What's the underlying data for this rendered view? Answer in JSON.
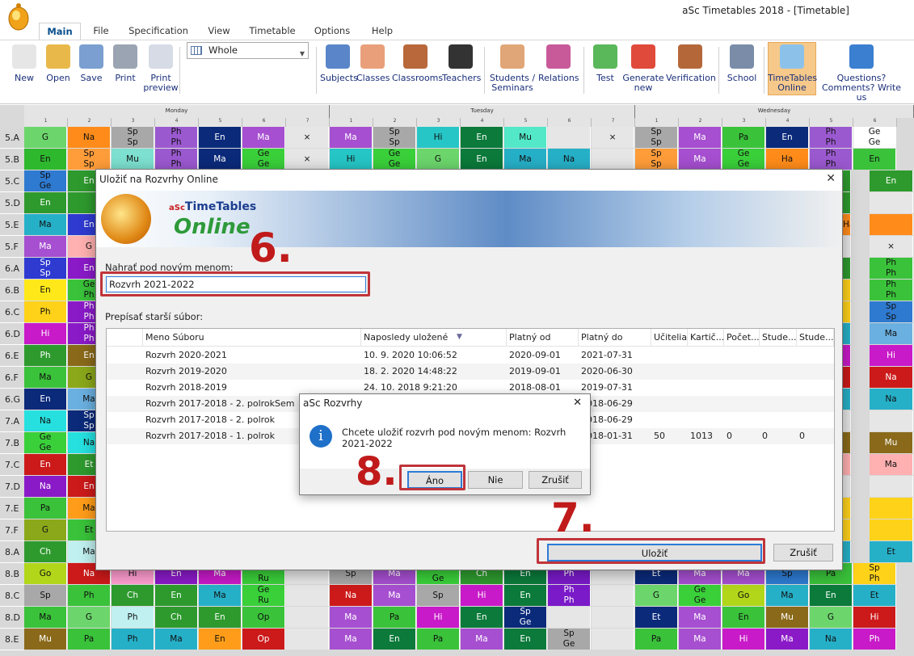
{
  "window": {
    "title": "aSc Timetables 2018  - [Timetable]"
  },
  "menu": {
    "tabs": [
      "Main",
      "File",
      "Specification",
      "View",
      "Timetable",
      "Options",
      "Help"
    ]
  },
  "ribbon": {
    "view_select": "Whole",
    "buttons": [
      {
        "id": "new",
        "label": "New",
        "icon": "new-file-icon",
        "color": "#e6e6e6"
      },
      {
        "id": "open",
        "label": "Open",
        "icon": "folder-icon",
        "color": "#e8b94a"
      },
      {
        "id": "save",
        "label": "Save",
        "icon": "floppy-icon",
        "color": "#7a9fd0"
      },
      {
        "id": "print",
        "label": "Print",
        "icon": "printer-icon",
        "color": "#9aa4b2"
      },
      {
        "id": "print-preview",
        "label": "Print\npreview",
        "icon": "print-preview-icon",
        "color": "#d6dbe6"
      },
      {
        "id": "subjects",
        "label": "Subjects",
        "icon": "book-icon",
        "color": "#5a86c9"
      },
      {
        "id": "classes",
        "label": "Classes",
        "icon": "students-icon",
        "color": "#e9a07a"
      },
      {
        "id": "classrooms",
        "label": "Classrooms",
        "icon": "door-icon",
        "color": "#b8683a"
      },
      {
        "id": "teachers",
        "label": "Teachers",
        "icon": "graduation-cap-icon",
        "color": "#333333"
      },
      {
        "id": "students-seminars",
        "label": "Students /\nSeminars",
        "icon": "student-check-icon",
        "color": "#e0a677"
      },
      {
        "id": "relations",
        "label": "Relations",
        "icon": "network-icon",
        "color": "#c85a9a"
      },
      {
        "id": "test",
        "label": "Test",
        "icon": "checkmark-icon",
        "color": "#5ab85a"
      },
      {
        "id": "generate-new",
        "label": "Generate\nnew",
        "icon": "siren-icon",
        "color": "#e04a3a"
      },
      {
        "id": "verification",
        "label": "Verification",
        "icon": "gavel-icon",
        "color": "#b4683a"
      },
      {
        "id": "school",
        "label": "School",
        "icon": "school-building-icon",
        "color": "#7a8ca8"
      },
      {
        "id": "timetables-online",
        "label": "TimeTables\nOnline",
        "icon": "cloud-icon",
        "color": "#8cc2ea"
      },
      {
        "id": "questions",
        "label": "Questions?\nComments? Write us",
        "icon": "question-icon",
        "color": "#3a7fd0"
      }
    ]
  },
  "timetable": {
    "days": [
      "Monday",
      "Tuesday",
      "Wednesday"
    ],
    "periods": [
      "1",
      "2",
      "3",
      "4",
      "5",
      "6",
      "7"
    ],
    "classes": [
      "5.A",
      "5.B",
      "5.C",
      "5.D",
      "5.E",
      "5.F",
      "6.A",
      "6.B",
      "6.C",
      "6.D",
      "6.E",
      "6.F",
      "6.G",
      "7.A",
      "7.B",
      "7.C",
      "7.D",
      "7.E",
      "7.F",
      "8.A",
      "8.B",
      "8.C",
      "8.D",
      "8.E"
    ],
    "rows": {
      "5.A": [
        [
          "G",
          "#6cd66c"
        ],
        [
          "Na",
          "#ff8c1a"
        ],
        [
          "Sp|Sp",
          "#a8a8a8"
        ],
        [
          "Ph|Ph",
          "#9b59d0"
        ],
        [
          "En",
          "#0b2a7a"
        ],
        [
          "Ma",
          "#a64fd0"
        ],
        [
          "×",
          "#e6e6e6"
        ],
        [
          "Ma",
          "#a64fd0"
        ],
        [
          "Sp|Sp",
          "#a8a8a8"
        ],
        [
          "Hi",
          "#27c6c6"
        ],
        [
          "En",
          "#0b7a3a"
        ],
        [
          "Mu",
          "#52e8c8"
        ],
        [
          "",
          ""
        ],
        [
          "×",
          "#e6e6e6"
        ],
        [
          "Sp|Sp",
          "#a8a8a8"
        ],
        [
          "Ma",
          "#a64fd0"
        ],
        [
          "Pa",
          "#3ac23a"
        ],
        [
          "En",
          "#0b2a7a"
        ],
        [
          "Ph|Ph",
          "#9b59d0"
        ],
        [
          "Ge|Ge",
          "#ffffff"
        ]
      ],
      "5.B": [
        [
          "En",
          "#2eb82e"
        ],
        [
          "Sp|Sp",
          "#ff9d3a"
        ],
        [
          "Mu",
          "#7de0d0"
        ],
        [
          "Ph|Ph",
          "#9b59d0"
        ],
        [
          "Ma",
          "#0b2a7a"
        ],
        [
          "Ge|Ge",
          "#3ad03a"
        ],
        [
          "×",
          "#e6e6e6"
        ],
        [
          "Hi",
          "#26c6c6"
        ],
        [
          "Ge|Ge",
          "#3ad03a"
        ],
        [
          "G",
          "#6cd66c"
        ],
        [
          "En",
          "#0b7a3a"
        ],
        [
          "Ma",
          "#26b0c8"
        ],
        [
          "Na",
          "#26b0c8"
        ],
        [
          "",
          ""
        ],
        [
          "Sp|Sp",
          "#ff9d3a"
        ],
        [
          "Ma",
          "#a64fd0"
        ],
        [
          "Ge|Ge",
          "#3ad03a"
        ],
        [
          "Ha",
          "#ff8c1a"
        ],
        [
          "Ph|Ph",
          "#9b59d0"
        ],
        [
          "En",
          "#3ac23a"
        ]
      ],
      "8.A": [
        [
          "Ch",
          "#2e9a2e"
        ],
        [
          "Ma",
          "#c0f0f0"
        ]
      ],
      "8.B": [
        [
          "Go",
          "#b2d61a"
        ],
        [
          "Na",
          "#cc1a1a"
        ],
        [
          "Hi",
          "#ff9dd0"
        ],
        [
          "En",
          "#8a1ac8"
        ],
        [
          "Ma",
          "#c81ac8"
        ],
        [
          "Ge|Ru",
          "#3ad03a"
        ],
        [
          "",
          ""
        ],
        [
          "Sp",
          "#a8a8a8"
        ],
        [
          "Ma",
          "#a64fd0"
        ],
        [
          "Ge|Ge",
          "#3ad03a"
        ],
        [
          "Ch",
          "#2e9a2e"
        ],
        [
          "En",
          "#0b7a3a"
        ],
        [
          "Ph",
          "#7a1ac8"
        ],
        [
          "",
          ""
        ],
        [
          "Et",
          "#0b2a7a"
        ],
        [
          "Ma",
          "#a64fd0"
        ],
        [
          "Ma",
          "#a64fd0"
        ],
        [
          "Sp",
          "#2e7ad0"
        ],
        [
          "Pa",
          "#3ac23a"
        ],
        [
          "Sp|Ph",
          "#ffd21a"
        ]
      ],
      "8.C": [
        [
          "Sp",
          "#a8a8a8"
        ],
        [
          "Ph",
          "#3ac23a"
        ],
        [
          "Ch",
          "#2e9a2e"
        ],
        [
          "En",
          "#2e9a2e"
        ],
        [
          "Ma",
          "#26b0c8"
        ],
        [
          "Ge|Ru",
          "#3ad03a"
        ],
        [
          "",
          ""
        ],
        [
          "Na",
          "#cc1a1a"
        ],
        [
          "Ma",
          "#a64fd0"
        ],
        [
          "Sp",
          "#a8a8a8"
        ],
        [
          "Hi",
          "#c81ac8"
        ],
        [
          "En",
          "#0b7a3a"
        ],
        [
          "Ph|Ph",
          "#7a1ac8"
        ],
        [
          "",
          ""
        ],
        [
          "G",
          "#6cd66c"
        ],
        [
          "Ge|Ge",
          "#3ad03a"
        ],
        [
          "Go",
          "#b2d61a"
        ],
        [
          "Ma",
          "#26b0c8"
        ],
        [
          "En",
          "#0b7a3a"
        ],
        [
          "Et",
          "#26b0c8"
        ]
      ],
      "8.D": [
        [
          "Ma",
          "#3ac23a"
        ],
        [
          "G",
          "#6cd66c"
        ],
        [
          "Ph",
          "#c0f0f0"
        ],
        [
          "Ch",
          "#2e9a2e"
        ],
        [
          "En",
          "#2e9a2e"
        ],
        [
          "Op",
          "#3ac23a"
        ],
        [
          "",
          ""
        ],
        [
          "Ma",
          "#a64fd0"
        ],
        [
          "Pa",
          "#3ac23a"
        ],
        [
          "Hi",
          "#c81ac8"
        ],
        [
          "En",
          "#0b7a3a"
        ],
        [
          "Sp|Ge",
          "#0b2a7a"
        ],
        [
          "",
          ""
        ],
        [
          "",
          ""
        ],
        [
          "Et",
          "#0b2a7a"
        ],
        [
          "Ma",
          "#a64fd0"
        ],
        [
          "En",
          "#3ac23a"
        ],
        [
          "Mu",
          "#8a6a1a"
        ],
        [
          "G",
          "#6cd66c"
        ],
        [
          "Hi",
          "#cc1a1a"
        ]
      ],
      "8.E": [
        [
          "Mu",
          "#8a6a1a"
        ],
        [
          "Pa",
          "#3ac23a"
        ],
        [
          "Ph",
          "#26b0c8"
        ],
        [
          "Ma",
          "#26b0c8"
        ],
        [
          "En",
          "#ff9d1a"
        ],
        [
          "Op",
          "#cc1a1a"
        ],
        [
          "",
          ""
        ],
        [
          "Ma",
          "#a64fd0"
        ],
        [
          "En",
          "#0b7a3a"
        ],
        [
          "Pa",
          "#3ac23a"
        ],
        [
          "Ma",
          "#a64fd0"
        ],
        [
          "En",
          "#0b7a3a"
        ],
        [
          "Sp|Ge",
          "#a8a8a8"
        ],
        [
          "",
          ""
        ],
        [
          "Pa",
          "#3ac23a"
        ],
        [
          "Ma",
          "#a64fd0"
        ],
        [
          "Hi",
          "#c81ac8"
        ],
        [
          "Ma",
          "#8a1ac8"
        ],
        [
          "Na",
          "#26b0c8"
        ],
        [
          "Ph",
          "#c81ac8"
        ]
      ]
    },
    "left_fill": {
      "5.C": [
        [
          "Sp|Ge",
          "#2e7ad0"
        ],
        [
          "En",
          "#2e9a2e"
        ]
      ],
      "5.D": [
        [
          "En",
          "#2e9a2e"
        ],
        [
          "",
          "#2e9a2e"
        ]
      ],
      "5.E": [
        [
          "Ma",
          "#26b0c8"
        ],
        [
          "En",
          "#2e3ad0"
        ]
      ],
      "5.F": [
        [
          "Ma",
          "#a64fd0"
        ],
        [
          "G",
          "#ffb0b0"
        ]
      ],
      "6.A": [
        [
          "Sp|Sp",
          "#2e3ad0"
        ],
        [
          "En",
          "#8a1ac8"
        ]
      ],
      "6.B": [
        [
          "En",
          "#ffe81a"
        ],
        [
          "Ge|Ph",
          "#3ac23a"
        ]
      ],
      "6.C": [
        [
          "Ph",
          "#ffd21a"
        ],
        [
          "Ph|Ph",
          "#8a1ac8"
        ]
      ],
      "6.D": [
        [
          "Hi",
          "#c81ac8"
        ],
        [
          "Ph|Ph",
          "#8a1ac8"
        ]
      ],
      "6.E": [
        [
          "Ph",
          "#2e9a2e"
        ],
        [
          "En",
          "#8a6a1a"
        ]
      ],
      "6.F": [
        [
          "Ma",
          "#3ac23a"
        ],
        [
          "G",
          "#8aa81a"
        ]
      ],
      "6.G": [
        [
          "En",
          "#0b2a7a"
        ],
        [
          "Ma",
          "#6ab0e0"
        ]
      ],
      "7.A": [
        [
          "Na",
          "#26e0e0"
        ],
        [
          "Sp|Sp",
          "#0b2a7a"
        ]
      ],
      "7.B": [
        [
          "Ge|Ge",
          "#3ad03a"
        ],
        [
          "Na",
          "#26e0e0"
        ]
      ],
      "7.C": [
        [
          "En",
          "#cc1a1a"
        ],
        [
          "Et",
          "#2e9a2e"
        ]
      ],
      "7.D": [
        [
          "Na",
          "#8a1ac8"
        ],
        [
          "En",
          "#cc1a1a"
        ]
      ],
      "7.E": [
        [
          "Pa",
          "#3ac23a"
        ],
        [
          "Ma",
          "#ff9d1a"
        ]
      ],
      "7.F": [
        [
          "G",
          "#8aa81a"
        ],
        [
          "Et",
          "#3ac23a"
        ]
      ]
    },
    "right_fill": {
      "5.C": [
        [
          "",
          "#2e9a2e"
        ],
        [
          "En",
          "#2e9a2e"
        ]
      ],
      "5.D": [
        [
          "",
          "#2e9a2e"
        ],
        [
          "",
          "#e6e6e6"
        ]
      ],
      "5.E": [
        [
          "Ha",
          "#ff8c1a"
        ],
        [
          "",
          "#ff8c1a"
        ]
      ],
      "5.F": [
        [
          "",
          "#e6e6e6"
        ],
        [
          "×",
          "#e6e6e6"
        ]
      ],
      "6.A": [
        [
          "",
          "#2e9a2e"
        ],
        [
          "Ph|Ph",
          "#3ac23a"
        ]
      ],
      "6.B": [
        [
          "",
          "#ffd21a"
        ],
        [
          "Ph|Ph",
          "#3ac23a"
        ]
      ],
      "6.C": [
        [
          "",
          "#ffd21a"
        ],
        [
          "Sp|Sp",
          "#2e7ad0"
        ]
      ],
      "6.D": [
        [
          "",
          "#26b0c8"
        ],
        [
          "Ma",
          "#6ab0e0"
        ]
      ],
      "6.E": [
        [
          "",
          "#c81ac8"
        ],
        [
          "Hi",
          "#c81ac8"
        ]
      ],
      "6.F": [
        [
          "",
          "#cc1a1a"
        ],
        [
          "Na",
          "#cc1a1a"
        ]
      ],
      "6.G": [
        [
          "",
          "#26b0c8"
        ],
        [
          "Na",
          "#26b0c8"
        ]
      ],
      "7.A": [
        [
          "",
          "#e6e6e6"
        ],
        [
          "",
          "#e6e6e6"
        ]
      ],
      "7.B": [
        [
          "",
          "#8a6a1a"
        ],
        [
          "Mu",
          "#8a6a1a"
        ]
      ],
      "7.C": [
        [
          "",
          "#ffb0b0"
        ],
        [
          "Ma",
          "#ffb0b0"
        ]
      ],
      "7.D": [
        [
          "",
          "#e6e6e6"
        ],
        [
          "",
          "#e6e6e6"
        ]
      ],
      "7.E": [
        [
          "",
          "#ffd21a"
        ],
        [
          "",
          "#ffd21a"
        ]
      ],
      "7.F": [
        [
          "",
          "#ffd21a"
        ],
        [
          "",
          "#ffd21a"
        ]
      ],
      "8.A": [
        [
          "",
          "#26b0c8"
        ],
        [
          "Et",
          "#26b0c8"
        ]
      ]
    }
  },
  "dialog": {
    "title": "Uložiť na Rozvrhy Online",
    "brand_small": "aSc",
    "brand": "TimeTables",
    "brand_online": "Online",
    "new_name_label": "Nahrať pod novým menom:",
    "new_name_value": "Rozvrh 2021-2022",
    "overwrite_label": "Prepísať starší súbor:",
    "columns": [
      "Meno Súboru",
      "Naposledy uložené",
      "Platný od",
      "Platný do",
      "Učitelia",
      "Kartič...",
      "Počet...",
      "Stude...",
      "Stude..."
    ],
    "rows": [
      [
        "Rozvrh 2020-2021",
        "10. 9. 2020 10:06:52",
        "2020-09-01",
        "2021-07-31",
        "",
        "",
        "",
        "",
        ""
      ],
      [
        "Rozvrh 2019-2020",
        "18. 2. 2020 14:48:22",
        "2019-09-01",
        "2020-06-30",
        "",
        "",
        "",
        "",
        ""
      ],
      [
        "Rozvrh 2018-2019",
        "24. 10. 2018 9:21:20",
        "2018-08-01",
        "2019-07-31",
        "",
        "",
        "",
        "",
        ""
      ],
      [
        "Rozvrh 2017-2018 - 2. polrokSem",
        "",
        "",
        "2018-06-29",
        "",
        "",
        "",
        "",
        ""
      ],
      [
        "Rozvrh 2017-2018 - 2. polrok",
        "",
        "",
        "2018-06-29",
        "",
        "",
        "",
        "",
        ""
      ],
      [
        "Rozvrh 2017-2018 - 1. polrok",
        "",
        "",
        "2018-01-31",
        "50",
        "1013",
        "0",
        "0",
        "0"
      ]
    ],
    "save_button": "Uložiť",
    "cancel_button": "Zrušiť"
  },
  "message_box": {
    "title": "aSc Rozvrhy",
    "text": "Chcete uložiť rozvrh pod novým menom: Rozvrh 2021-2022",
    "yes": "Áno",
    "no": "Nie",
    "cancel": "Zrušiť"
  },
  "annotations": {
    "step6": "6.",
    "step7": "7.",
    "step8": "8."
  }
}
